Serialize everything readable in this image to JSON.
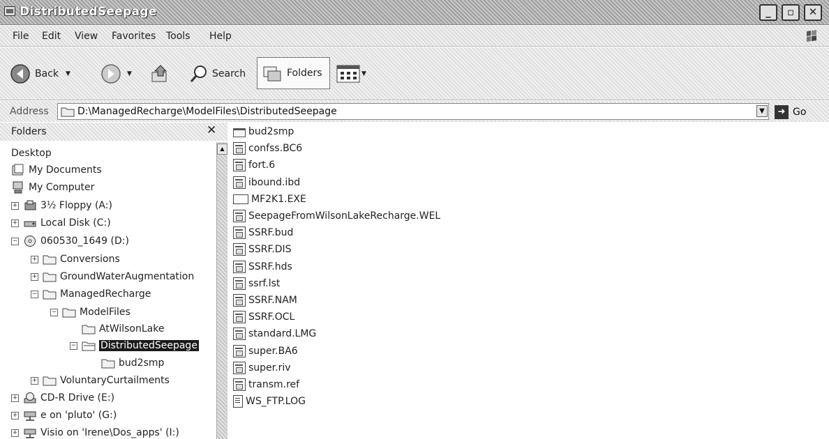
{
  "window": {
    "title": "DistributedSeepage"
  },
  "menu": [
    "File",
    "Edit",
    "View",
    "Favorites",
    "Tools",
    "Help"
  ],
  "toolbar": {
    "back": "Back",
    "search": "Search",
    "folders": "Folders"
  },
  "address": {
    "label": "Address",
    "path": "D:\\ManagedRecharge\\ModelFiles\\DistributedSeepage",
    "go": "Go"
  },
  "folders_pane": {
    "title": "Folders",
    "tree": [
      {
        "label": "Desktop",
        "icon": "none",
        "expander": ""
      },
      {
        "label": "My Documents",
        "icon": "documents-icon",
        "expander": ""
      },
      {
        "label": "My Computer",
        "icon": "computer-icon",
        "expander": ""
      },
      {
        "label": "3½ Floppy (A:)",
        "icon": "floppy-icon",
        "expander": "+"
      },
      {
        "label": "Local Disk (C:)",
        "icon": "disk-icon",
        "expander": "+"
      },
      {
        "label": "060530_1649 (D:)",
        "icon": "cd-icon",
        "expander": "−"
      },
      {
        "label": "Conversions",
        "icon": "folder-icon",
        "expander": "+"
      },
      {
        "label": "GroundWaterAugmentation",
        "icon": "folder-icon",
        "expander": "+"
      },
      {
        "label": "ManagedRecharge",
        "icon": "folder-icon",
        "expander": "−"
      },
      {
        "label": "ModelFiles",
        "icon": "folder-icon",
        "expander": "−"
      },
      {
        "label": "AtWilsonLake",
        "icon": "folder-icon",
        "expander": ""
      },
      {
        "label": "DistributedSeepage",
        "icon": "folder-open-icon",
        "expander": "−",
        "selected": true
      },
      {
        "label": "bud2smp",
        "icon": "folder-icon",
        "expander": ""
      },
      {
        "label": "VoluntaryCurtailments",
        "icon": "folder-icon",
        "expander": "+"
      },
      {
        "label": "CD-R Drive (E:)",
        "icon": "cd-drive-icon",
        "expander": "+"
      },
      {
        "label": "e on 'pluto' (G:)",
        "icon": "network-drive-icon",
        "expander": "+"
      },
      {
        "label": "Visio on 'Irene\\Dos_apps' (I:)",
        "icon": "network-drive-icon",
        "expander": "+"
      }
    ]
  },
  "files": [
    {
      "name": "bud2smp",
      "icon": "folder-icon"
    },
    {
      "name": "confss.BC6",
      "icon": "file-icon"
    },
    {
      "name": "fort.6",
      "icon": "file-icon"
    },
    {
      "name": "ibound.ibd",
      "icon": "file-icon"
    },
    {
      "name": "MF2K1.EXE",
      "icon": "exe-icon"
    },
    {
      "name": "SeepageFromWilsonLakeRecharge.WEL",
      "icon": "file-icon"
    },
    {
      "name": "SSRF.bud",
      "icon": "file-icon"
    },
    {
      "name": "SSRF.DIS",
      "icon": "file-icon"
    },
    {
      "name": "SSRF.hds",
      "icon": "file-icon"
    },
    {
      "name": "ssrf.lst",
      "icon": "file-icon"
    },
    {
      "name": "SSRF.NAM",
      "icon": "file-icon"
    },
    {
      "name": "SSRF.OCL",
      "icon": "file-icon"
    },
    {
      "name": "standard.LMG",
      "icon": "file-icon"
    },
    {
      "name": "super.BA6",
      "icon": "file-icon"
    },
    {
      "name": "super.riv",
      "icon": "file-icon"
    },
    {
      "name": "transm.ref",
      "icon": "file-icon"
    },
    {
      "name": "WS_FTP.LOG",
      "icon": "log-icon"
    }
  ]
}
